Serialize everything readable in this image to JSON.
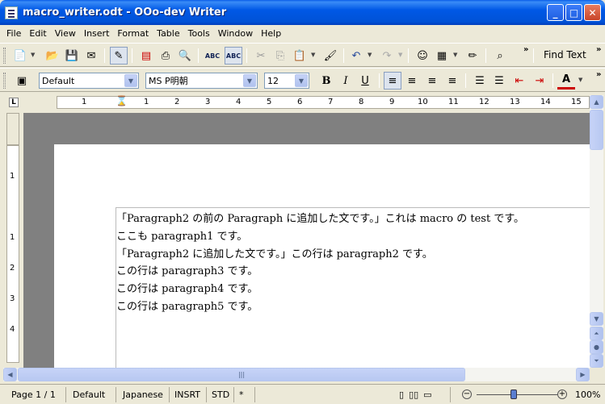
{
  "window": {
    "title": "macro_writer.odt - OOo-dev Writer"
  },
  "menu": [
    "File",
    "Edit",
    "View",
    "Insert",
    "Format",
    "Table",
    "Tools",
    "Window",
    "Help"
  ],
  "toolbar": {
    "find_text": "Find Text"
  },
  "formatting": {
    "paragraph_style": "Default",
    "font_name": "MS P明朝",
    "font_size": "12"
  },
  "ruler": {
    "h_labels": [
      "1",
      "1",
      "2",
      "3",
      "4",
      "5",
      "6",
      "7",
      "8",
      "9",
      "10",
      "11",
      "12",
      "13",
      "14",
      "15"
    ],
    "v_labels": [
      "1",
      "1",
      "2",
      "3",
      "4"
    ]
  },
  "document": {
    "paragraphs": [
      "「Paragraph2 の前の Paragraph に追加した文です。」これは macro の test です。",
      "ここも paragraph1 です。",
      "「Paragraph2 に追加した文です。」この行は paragraph2 です。",
      "この行は paragraph3 です。",
      "この行は paragraph4 です。",
      "この行は paragraph5 です。"
    ]
  },
  "status": {
    "page": "Page 1 / 1",
    "style": "Default",
    "language": "Japanese",
    "insert_mode": "INSRT",
    "selection_mode": "STD",
    "modified": "*",
    "zoom": "100%"
  }
}
